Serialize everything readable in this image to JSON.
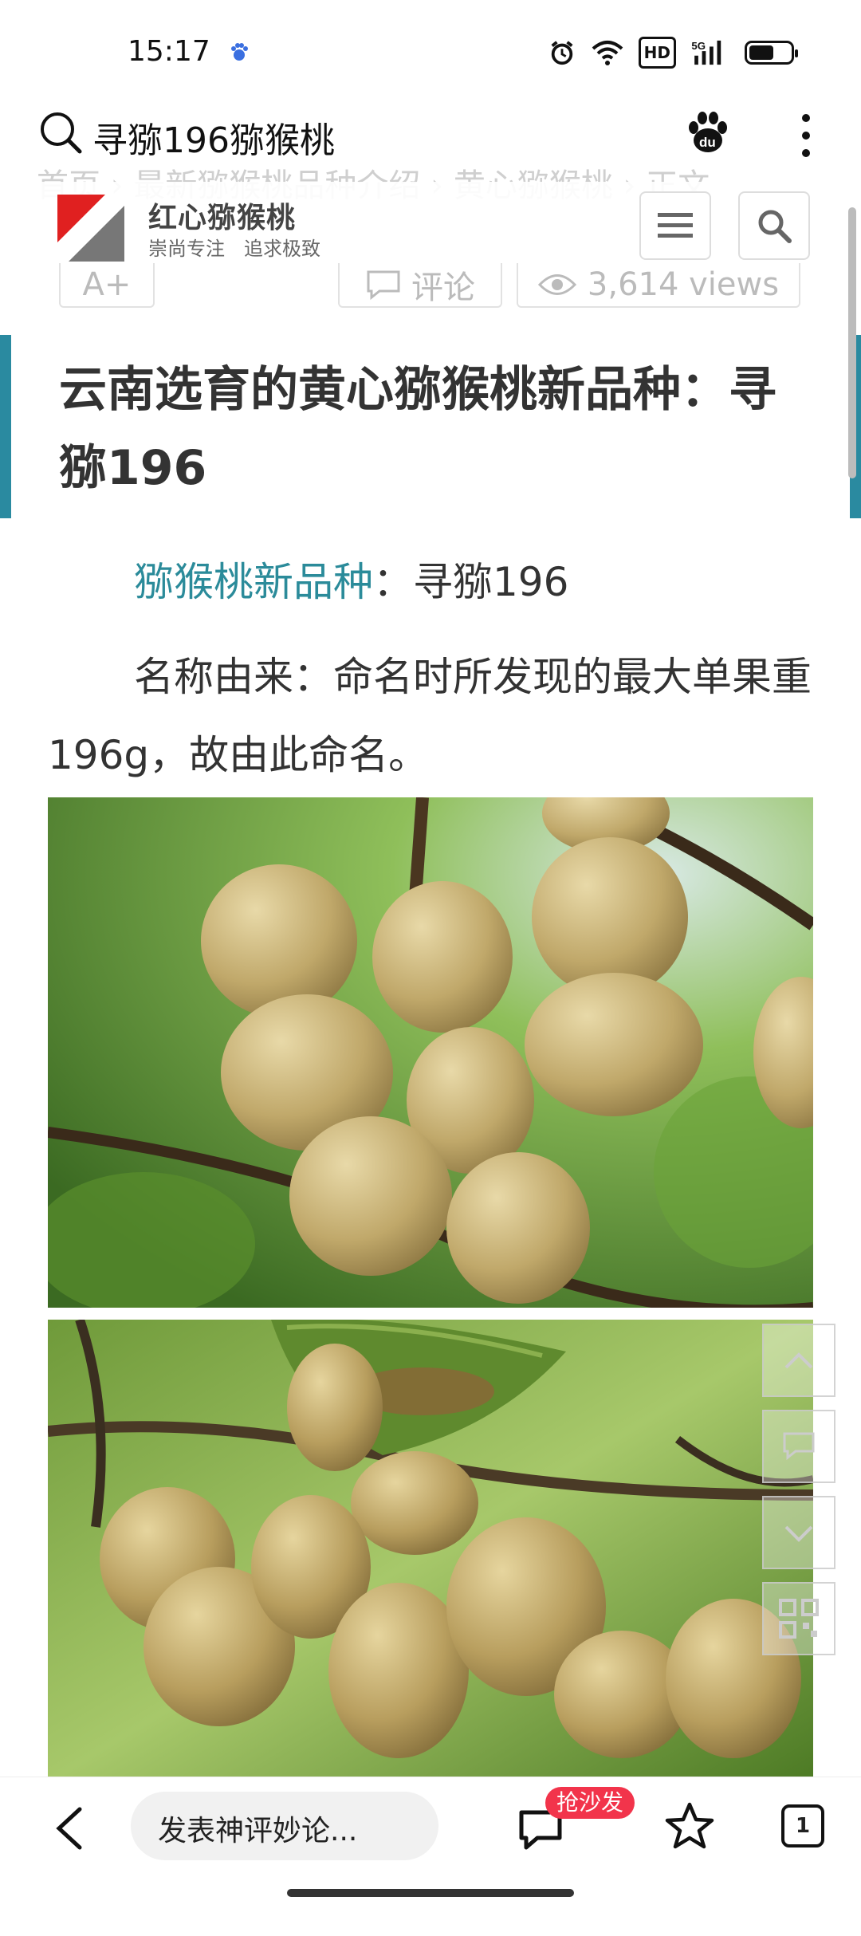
{
  "status_bar": {
    "time": "15:17",
    "hd_label": "HD",
    "network_label": "5G",
    "icons": [
      "baidu-icon",
      "alarm-icon",
      "wifi-icon",
      "hd-icon",
      "signal-icon",
      "battery-icon"
    ],
    "battery_level": 0.6
  },
  "search_bar": {
    "query": "寻猕196猕猴桃",
    "icons": [
      "search-icon",
      "baidu-paw-icon",
      "more-vertical-icon"
    ]
  },
  "site_header": {
    "brand": "红心猕猴桃",
    "slogan": "崇尚专注　追求极致",
    "breadcrumb_partial": "首页 › 最新猕猴桃品种介绍 › 黄心猕猴桃 › 正文",
    "menu_icon": "menu-icon",
    "search_icon": "search-icon"
  },
  "meta": {
    "font_size_label": "A+",
    "comment_label": "评论",
    "views_label": "3,614 views"
  },
  "article": {
    "title": "云南选育的黄心猕猴桃新品种：寻猕196",
    "p1_link": "猕猴桃新品种",
    "p1_rest": "：寻猕196",
    "p2": "名称由来：命名时所发现的最大单果重196g，故由此命名。"
  },
  "floating_tools": [
    "arrow-up-icon",
    "comment-icon",
    "arrow-down-icon",
    "qrcode-icon"
  ],
  "bottom_nav": {
    "comment_placeholder": "发表神评妙论...",
    "badge": "抢沙发",
    "tab_count": "1"
  },
  "colors": {
    "accent_teal": "#2a8aa0",
    "link": "#2b8b9a",
    "badge_red": "#f2344b",
    "logo_red": "#e02020"
  }
}
